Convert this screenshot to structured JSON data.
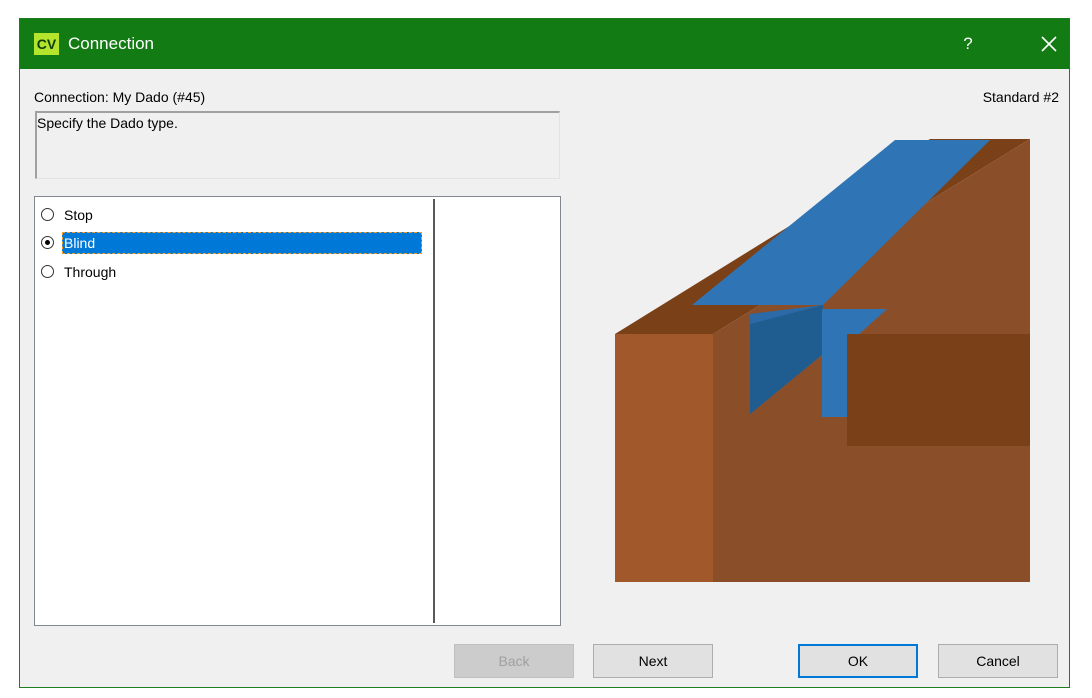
{
  "window": {
    "icon_text": "CV",
    "title": "Connection",
    "help_label": "?",
    "close_icon": "close-icon"
  },
  "header": {
    "connection_label": "Connection: My Dado (#45)",
    "standard_label": "Standard #2"
  },
  "description": "Specify the Dado type.",
  "options": [
    {
      "label": "Stop",
      "checked": false
    },
    {
      "label": "Blind",
      "checked": true
    },
    {
      "label": "Through",
      "checked": false
    }
  ],
  "buttons": {
    "back": "Back",
    "next": "Next",
    "ok": "OK",
    "cancel": "Cancel"
  },
  "colors": {
    "titlebar": "#137b13",
    "selection": "#0078d7",
    "wood_light": "#a1582a",
    "wood_mid": "#8a4f29",
    "wood_dark": "#7a4119",
    "groove": "#2f74b5"
  }
}
